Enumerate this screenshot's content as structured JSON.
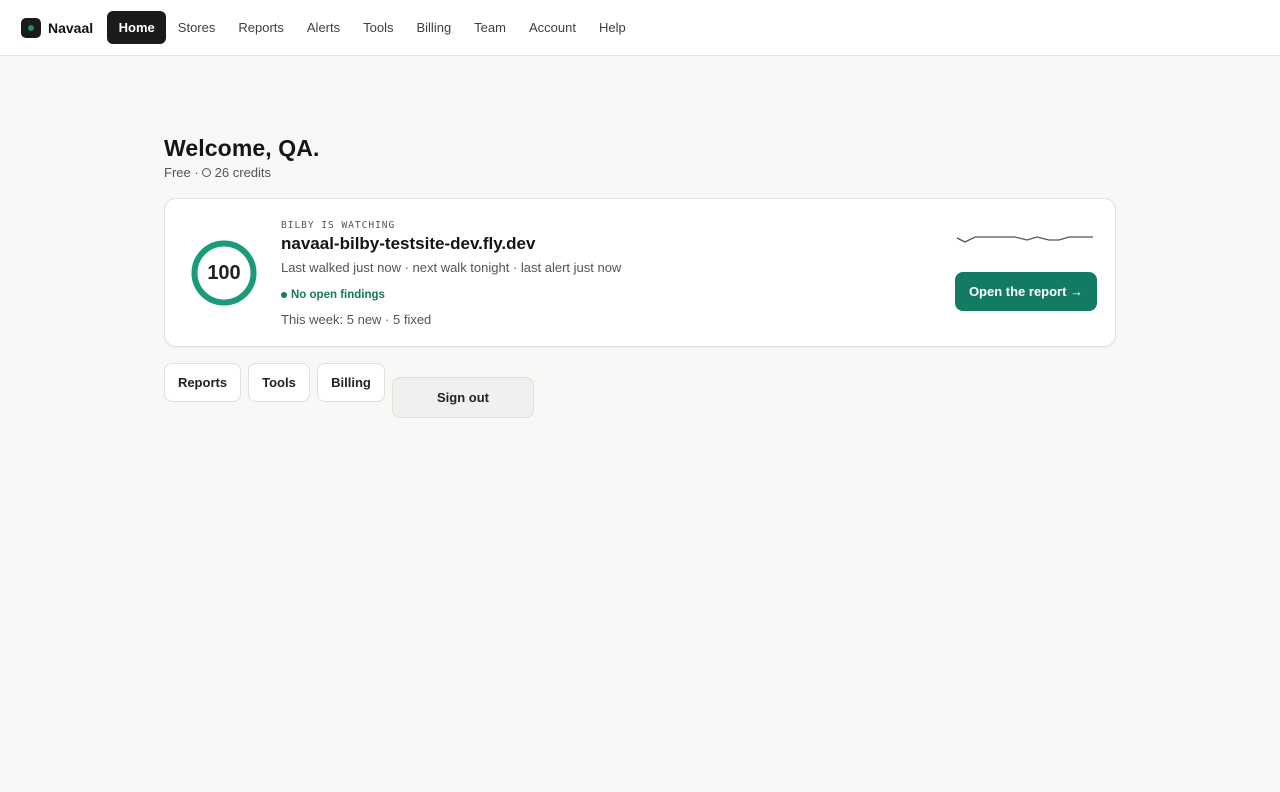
{
  "brand": {
    "name": "Navaal"
  },
  "nav": {
    "items": [
      {
        "label": "Home",
        "active": true
      },
      {
        "label": "Stores"
      },
      {
        "label": "Reports"
      },
      {
        "label": "Alerts"
      },
      {
        "label": "Tools"
      },
      {
        "label": "Billing"
      },
      {
        "label": "Team"
      },
      {
        "label": "Account"
      },
      {
        "label": "Help"
      }
    ]
  },
  "welcome": {
    "title": "Welcome, QA.",
    "plan": "Free ·",
    "credits": "26 credits"
  },
  "card": {
    "score": "100",
    "score_fraction": 1.0,
    "eyebrow": "BILBY IS WATCHING",
    "site": "navaal-bilby-testsite-dev.fly.dev",
    "meta": "Last walked just now · next walk tonight · last alert just now",
    "findings": "No open findings",
    "week": "This week: 5 new · 5 fixed",
    "cta": "Open the report →"
  },
  "actions": {
    "reports": "Reports",
    "tools": "Tools",
    "billing": "Billing",
    "signout": "Sign out"
  },
  "colors": {
    "accent": "#137a63",
    "ring": "#1a9a78",
    "nav_active_bg": "#1b1b1b",
    "findings": "#137a5a"
  }
}
